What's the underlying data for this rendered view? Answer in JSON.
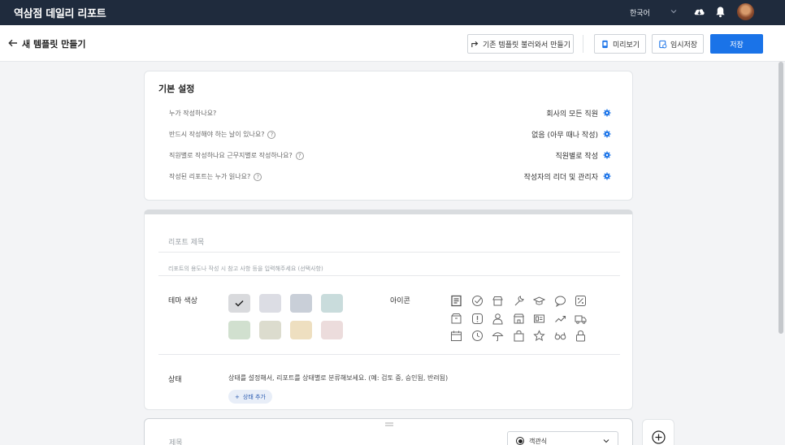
{
  "app": {
    "title": "역삼점 데일리 리포트",
    "language": "한국어"
  },
  "header": {
    "page_title": "새 템플릿 만들기",
    "load_template_label": "기존 템플릿 불러와서 만들기",
    "preview_label": "미리보기",
    "draft_label": "임시저장",
    "save_label": "저장"
  },
  "basic": {
    "title": "기본 설정",
    "rows": [
      {
        "question": "누가 작성하나요?",
        "answer": "회사의 모든 직원",
        "help": false
      },
      {
        "question": "반드시 작성해야 하는 날이 있나요?",
        "answer": "없음 (아무 때나 작성)",
        "help": true
      },
      {
        "question": "직원별로 작성하나요 근무지별로 작성하나요?",
        "answer": "직원별로 작성",
        "help": true
      },
      {
        "question": "작성된 리포트는 누가 읽나요?",
        "answer": "작성자의 리더 및 관리자",
        "help": true
      }
    ]
  },
  "report": {
    "title_placeholder": "리포트 제목",
    "desc_placeholder": "리포트의 용도나 작성 시 참고 사항 등을 입력해주세요 (선택사항)",
    "theme_label": "테마 색상",
    "icon_label": "아이콘",
    "theme_colors": [
      "#d9dadd",
      "#dcdde4",
      "#c9cfd8",
      "#c9dcdc",
      "#d1e0cf",
      "#dcdcce",
      "#eedfc0",
      "#ecdcdc"
    ],
    "selected_theme_index": 0,
    "icons": [
      "document-icon",
      "check-circle-icon",
      "store-icon",
      "wrench-icon",
      "graduation-cap-icon",
      "chat-bubble-icon",
      "percent-icon",
      "box-icon",
      "alert-icon",
      "person-icon",
      "shop-icon",
      "id-card-icon",
      "trending-up-icon",
      "truck-icon",
      "calendar-icon",
      "clock-icon",
      "umbrella-icon",
      "bag-icon",
      "star-icon",
      "glasses-icon",
      "lock-icon"
    ],
    "status_label": "상태",
    "status_help": "상태를 설정해서, 리포트를 상태별로 분류해보세요. (예: 검토 중, 승인됨, 반려됨)",
    "status_add_label": "상태 추가"
  },
  "question": {
    "title_placeholder": "제목",
    "type_label": "객관식"
  }
}
